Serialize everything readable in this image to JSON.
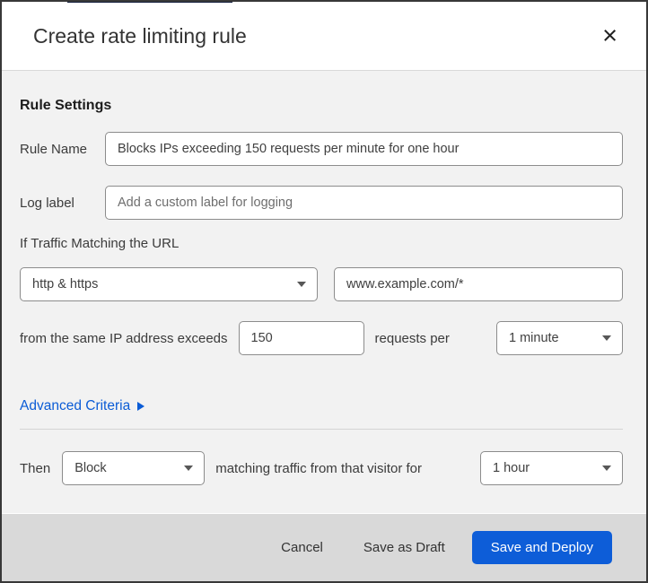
{
  "dialog": {
    "title": "Create rate limiting rule",
    "close_icon": "×"
  },
  "form": {
    "section_heading": "Rule Settings",
    "rule_name": {
      "label": "Rule Name",
      "value": "Blocks IPs exceeding 150 requests per minute for one hour"
    },
    "log_label": {
      "label": "Log label",
      "placeholder": "Add a custom label for logging"
    },
    "traffic_match": {
      "heading": "If Traffic Matching the URL",
      "scheme_selected": "http & https",
      "url_value": "www.example.com/*"
    },
    "threshold": {
      "prefix": "from the same IP address exceeds",
      "requests_value": "150",
      "middle": "requests per",
      "period_selected": "1 minute"
    },
    "advanced_link": "Advanced Criteria",
    "action": {
      "prefix": "Then",
      "action_selected": "Block",
      "middle": "matching traffic from that visitor for",
      "duration_selected": "1 hour"
    }
  },
  "footer": {
    "cancel_label": "Cancel",
    "save_draft_label": "Save as Draft",
    "save_deploy_label": "Save and Deploy"
  },
  "colors": {
    "dialog_border": "#383838",
    "top_strip": "#15203f",
    "header_border": "#d9d9d9",
    "body_bg": "#f2f2f2",
    "footer_bg": "#d9d9d9",
    "input_border": "#8c8c8c",
    "link_blue": "#0b5cd6",
    "button_blue": "#0d5dd8"
  }
}
